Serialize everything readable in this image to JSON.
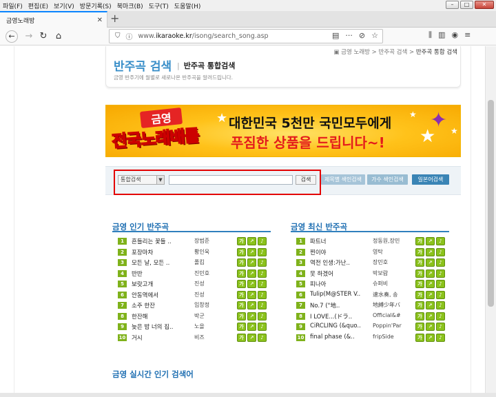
{
  "menubar": {
    "items": [
      "파일(F)",
      "편집(E)",
      "보기(V)",
      "방문기록(S)",
      "북마크(B)",
      "도구(T)",
      "도움말(H)"
    ]
  },
  "window_controls": {
    "minimize": "–",
    "maximize": "□",
    "close": "✕"
  },
  "tab": {
    "title": "금영노래방",
    "close": "✕",
    "new_tab": "+"
  },
  "navbar": {
    "url_prefix": "www.",
    "url_domain": "ikaraoke.kr",
    "url_path": "/isong/search_song.asp",
    "more": "···"
  },
  "breadcrumb": {
    "parts": [
      "금영 노래방",
      "반주곡 검색"
    ],
    "current": "반주곡 통합 검색"
  },
  "header": {
    "title": "반주곡 검색",
    "subtitle": "반주곡 통합검색",
    "description": "금영 반주기에 월별로 새로나온 반주곡을 알려드립니다."
  },
  "banner": {
    "logo_top": "금영",
    "logo_main": "전국노래배틀",
    "line1": "대한민국 5천만 국민모두에게",
    "line2": "푸짐한 상품을 드립니다~!"
  },
  "search": {
    "select_value": "통합검색",
    "input_value": "",
    "button_label": "검색",
    "by_title": "제목별 색인검색",
    "by_singer": "가수 색인검색",
    "japanese": "일본어검색"
  },
  "popular": {
    "title": "금영 인기 반주곡",
    "songs": [
      {
        "rank": "1",
        "title": "흔들리는 꽃들 ..",
        "artist": "장범준"
      },
      {
        "rank": "2",
        "title": "포장마차",
        "artist": "황인욱"
      },
      {
        "rank": "3",
        "title": "모든 날, 모든 ..",
        "artist": "폴킴"
      },
      {
        "rank": "4",
        "title": "반반",
        "artist": "진민호"
      },
      {
        "rank": "5",
        "title": "보랏고개",
        "artist": "진성"
      },
      {
        "rank": "6",
        "title": "안동역에서",
        "artist": "진성"
      },
      {
        "rank": "7",
        "title": "소주 한잔",
        "artist": "임창정"
      },
      {
        "rank": "8",
        "title": "한잔해",
        "artist": "박군"
      },
      {
        "rank": "9",
        "title": "늦은 밤 너의 집..",
        "artist": "노을"
      },
      {
        "rank": "10",
        "title": "거시",
        "artist": "비즈"
      }
    ]
  },
  "latest": {
    "title": "금영 최신 반주곡",
    "songs": [
      {
        "rank": "1",
        "title": "파트너",
        "artist": "정동원,장민"
      },
      {
        "rank": "2",
        "title": "찐이야",
        "artist": "영탁"
      },
      {
        "rank": "3",
        "title": "역전 인생:가난..",
        "artist": "장민호"
      },
      {
        "rank": "4",
        "title": "못 하겠어",
        "artist": "박보람"
      },
      {
        "rank": "5",
        "title": "피나아",
        "artist": "슈퍼비"
      },
      {
        "rank": "6",
        "title": "Tulip(M@STER V..",
        "artist": "速水奏, 송"
      },
      {
        "rank": "7",
        "title": "No.7 (\"地..",
        "artist": "地縛少年バ"
      },
      {
        "rank": "8",
        "title": "I LOVE...(ドラ..",
        "artist": "Official&#"
      },
      {
        "rank": "9",
        "title": "CiRCLING (&quo..",
        "artist": "Poppin'Par"
      },
      {
        "rank": "10",
        "title": "final phase (&..",
        "artist": "fripSide"
      }
    ]
  },
  "song_actions": [
    "가",
    "↗",
    "♪"
  ],
  "realtime": {
    "title": "금영 실시간 인기 검색어"
  },
  "colors": {
    "accent": "#1f6fb2",
    "rank_green": "#7fb21b",
    "highlight": "#e30000",
    "banner_red": "#e41b1b"
  }
}
